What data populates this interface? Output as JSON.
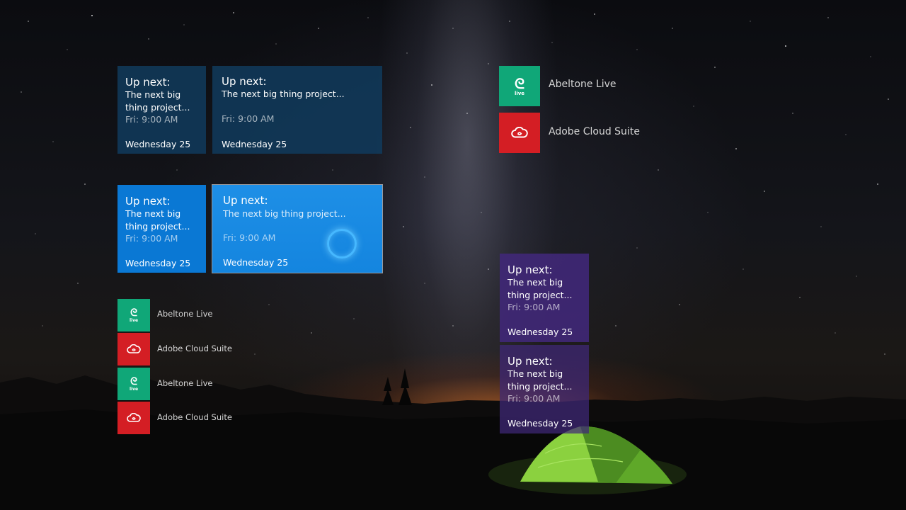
{
  "tiles": {
    "agenda_small_1": {
      "title": "Up next:",
      "body": "The next big thing project...",
      "time": "Fri: 9:00 AM",
      "date": "Wednesday 25"
    },
    "agenda_wide_1": {
      "title": "Up next:",
      "body": "The next big thing project...",
      "time": "Fri: 9:00 AM",
      "date": "Wednesday 25"
    },
    "agenda_small_2": {
      "title": "Up next:",
      "body": "The next big thing project...",
      "time": "Fri: 9:00 AM",
      "date": "Wednesday 25"
    },
    "agenda_wide_2": {
      "title": "Up next:",
      "body": "The next big thing project...",
      "time": "Fri: 9:00 AM",
      "date": "Wednesday 25"
    },
    "agenda_purple_1": {
      "title": "Up next:",
      "body": "The next big thing project...",
      "time": "Fri: 9:00 AM",
      "date": "Wednesday 25"
    },
    "agenda_purple_2": {
      "title": "Up next:",
      "body": "The next big thing project...",
      "time": "Fri: 9:00 AM",
      "date": "Wednesday 25"
    }
  },
  "app_list_large": [
    {
      "label": "Abeltone Live",
      "icon": "ableton-live-icon",
      "color": "#10a778"
    },
    {
      "label": "Adobe Cloud Suite",
      "icon": "adobe-cloud-icon",
      "color": "#d41e24"
    }
  ],
  "app_list_small": [
    {
      "label": "Abeltone Live",
      "icon": "ableton-live-icon",
      "color": "#10a778"
    },
    {
      "label": "Adobe Cloud Suite",
      "icon": "adobe-cloud-icon",
      "color": "#d41e24"
    },
    {
      "label": "Abeltone Live",
      "icon": "ableton-live-icon",
      "color": "#10a778"
    },
    {
      "label": "Adobe Cloud Suite",
      "icon": "adobe-cloud-icon",
      "color": "#d41e24"
    }
  ],
  "icons": {
    "live_word": "live"
  },
  "colors": {
    "tile_dark": "#103a5c",
    "tile_blue": "#0a78d4",
    "tile_purple": "#402878",
    "ableton_green": "#10a778",
    "adobe_red": "#d41e24",
    "cortana_ring": "#46b8ff"
  }
}
